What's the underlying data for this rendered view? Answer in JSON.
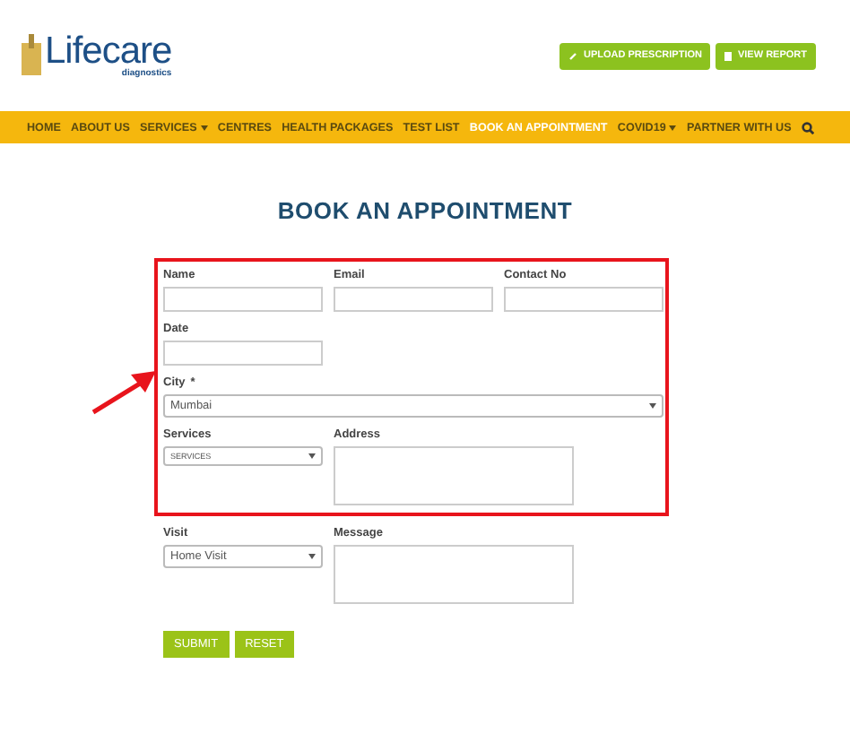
{
  "logo": {
    "name": "Lifecare",
    "tagline": "diagnostics"
  },
  "header_buttons": [
    {
      "label": "UPLOAD PRESCRIPTION",
      "kind": "upload"
    },
    {
      "label": "VIEW REPORT",
      "kind": "report"
    }
  ],
  "nav": [
    {
      "label": "HOME",
      "selected": false,
      "dropdown": false
    },
    {
      "label": "ABOUT US",
      "selected": false,
      "dropdown": false
    },
    {
      "label": "SERVICES",
      "selected": false,
      "dropdown": true
    },
    {
      "label": "CENTRES",
      "selected": false,
      "dropdown": false
    },
    {
      "label": "HEALTH PACKAGES",
      "selected": false,
      "dropdown": false
    },
    {
      "label": "TEST LIST",
      "selected": false,
      "dropdown": false
    },
    {
      "label": "BOOK AN APPOINTMENT",
      "selected": true,
      "dropdown": false
    },
    {
      "label": "COVID19",
      "selected": false,
      "dropdown": true
    },
    {
      "label": "PARTNER WITH US",
      "selected": false,
      "dropdown": false
    }
  ],
  "title": "BOOK AN APPOINTMENT",
  "highlighted_fields": [
    {
      "label": "Name",
      "kind": "input"
    },
    {
      "label": "Email",
      "kind": "input"
    },
    {
      "label": "Contact No",
      "kind": "input"
    },
    {
      "label": "Date",
      "kind": "input"
    },
    {
      "label": "City",
      "required": "*",
      "kind": "select",
      "value": "Mumbai"
    },
    {
      "label": "Services",
      "kind": "small-select",
      "value": "SERVICES"
    },
    {
      "label": "Address",
      "kind": "textarea"
    }
  ],
  "other_fields": [
    {
      "label": "Visit",
      "kind": "select",
      "value": "Home Visit"
    },
    {
      "label": "Message",
      "kind": "textarea"
    }
  ],
  "buttons": [
    "SUBMIT",
    "RESET"
  ]
}
